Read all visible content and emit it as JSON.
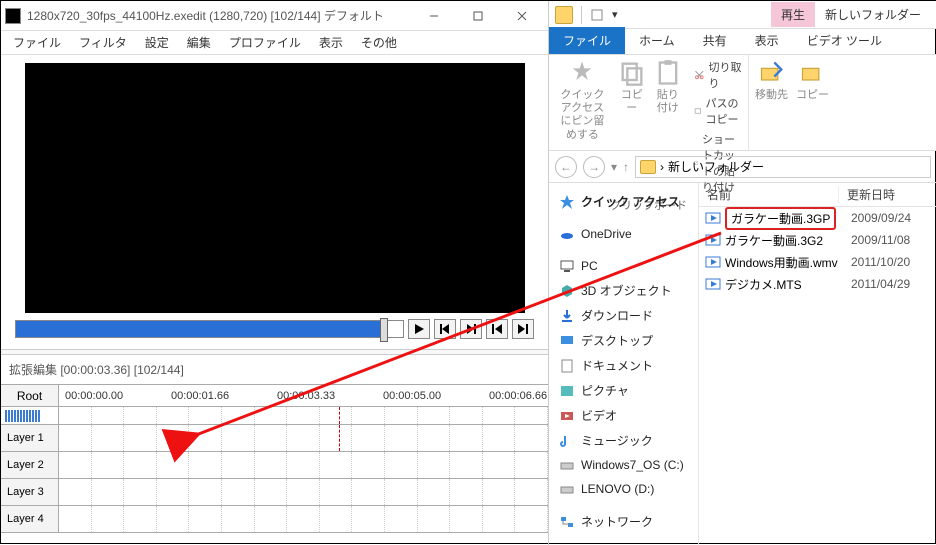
{
  "left": {
    "title": "1280x720_30fps_44100Hz.exedit (1280,720)  [102/144]  デフォルト",
    "menu": [
      "ファイル",
      "フィルタ",
      "設定",
      "編集",
      "プロファイル",
      "表示",
      "その他"
    ],
    "timeline_title": "拡張編集 [00:00:03.36] [102/144]",
    "root_label": "Root",
    "timecodes": [
      "00:00:00.00",
      "00:00:01.66",
      "00:00:03.33",
      "00:00:05.00",
      "00:00:06.66"
    ],
    "layers": [
      "Layer 1",
      "Layer 2",
      "Layer 3",
      "Layer 4"
    ]
  },
  "right": {
    "top_tabs": {
      "play": "再生",
      "newfolder": "新しいフォルダー"
    },
    "ribbon_tabs": {
      "file": "ファイル",
      "home": "ホーム",
      "share": "共有",
      "view": "表示",
      "video": "ビデオ ツール"
    },
    "ribbon": {
      "quick_access": "クイック アクセス\nにピン留めする",
      "copy": "コピー",
      "paste": "貼り付け",
      "cut": "切り取り",
      "copypath": "パスのコピー",
      "paste_shortcut": "ショートカットの貼り付け",
      "clipboard_label": "クリップボード",
      "moveto": "移動先",
      "copyto": "コピー"
    },
    "breadcrumb": "新しいフォルダー",
    "nav": {
      "quick": "クイック アクセス",
      "onedrive": "OneDrive",
      "pc": "PC",
      "threed": "3D オブジェクト",
      "download": "ダウンロード",
      "desktop": "デスクトップ",
      "documents": "ドキュメント",
      "pictures": "ピクチャ",
      "videos": "ビデオ",
      "music": "ミュージック",
      "cdrive": "Windows7_OS (C:)",
      "ddrive": "LENOVO (D:)",
      "network": "ネットワーク"
    },
    "columns": {
      "name": "名前",
      "date": "更新日時"
    },
    "files": [
      {
        "name": "ガラケー動画.3GP",
        "date": "2009/09/24",
        "selected": true
      },
      {
        "name": "ガラケー動画.3G2",
        "date": "2009/11/08"
      },
      {
        "name": "Windows用動画.wmv",
        "date": "2011/10/20"
      },
      {
        "name": "デジカメ.MTS",
        "date": "2011/04/29"
      }
    ]
  }
}
